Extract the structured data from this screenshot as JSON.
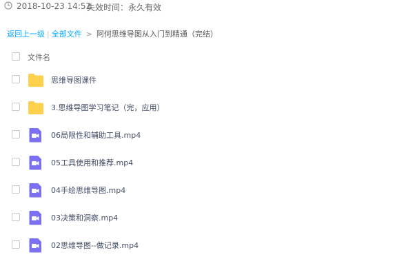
{
  "header": {
    "date": "2018-10-23 14:52",
    "expiry": "失效时间：永久有效"
  },
  "breadcrumb": {
    "back_label": "返回上一级",
    "separator": "|",
    "all_files_label": "全部文件",
    "arrow": ">",
    "current": "阿何思维导图从入门到精通（完结）"
  },
  "list": {
    "column_header": "文件名",
    "files": [
      {
        "name": "思维导图课件",
        "type": "folder"
      },
      {
        "name": "3.思维导图学习笔记（完，应用）",
        "type": "folder"
      },
      {
        "name": "06局限性和辅助工具.mp4",
        "type": "video"
      },
      {
        "name": "05工具使用和推荐.mp4",
        "type": "video"
      },
      {
        "name": "04手绘思维导图.mp4",
        "type": "video"
      },
      {
        "name": "03决策和洞察.mp4",
        "type": "video"
      },
      {
        "name": "02思维导图--做记录.mp4",
        "type": "video"
      }
    ]
  },
  "colors": {
    "link": "#09aaff",
    "folder": "#ffd04b",
    "video": "#7b6ff2"
  }
}
